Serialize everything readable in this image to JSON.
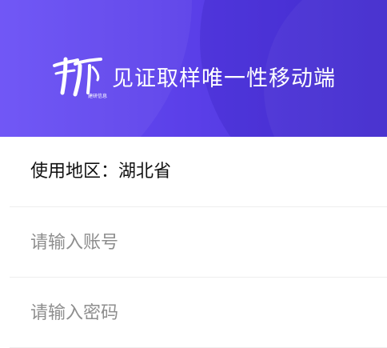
{
  "header": {
    "app_title": "见证取样唯一性移动端",
    "logo_caption": "建研信息"
  },
  "form": {
    "region": {
      "label": "使用地区：",
      "value": "湖北省"
    },
    "account": {
      "value": "",
      "placeholder": "请输入账号"
    },
    "password": {
      "value": "",
      "placeholder": "请输入密码"
    }
  },
  "colors": {
    "header_gradient_start": "#6a4ff6",
    "header_gradient_end": "#4a32d8",
    "title_text": "#ffffff",
    "placeholder_text": "#8e8e8e",
    "divider": "#eeeeee"
  }
}
